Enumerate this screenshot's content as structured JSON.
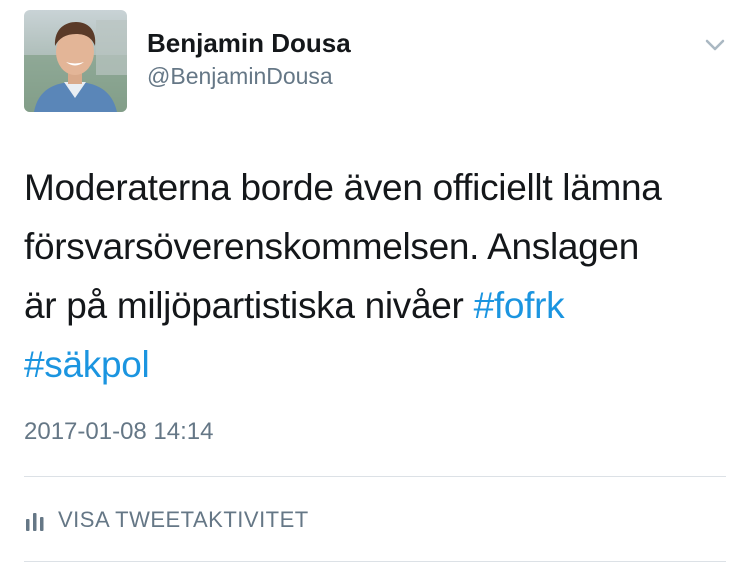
{
  "author": {
    "display_name": "Benjamin Dousa",
    "handle": "@BenjaminDousa",
    "avatar_icon": "profile-photo"
  },
  "menu": {
    "caret_icon": "chevron-down-icon"
  },
  "tweet": {
    "lines": [
      {
        "text": "Moderaterna borde även officiellt lämna"
      },
      {
        "text": "försvarsöverenskommelsen. Anslagen"
      },
      {
        "text": "är på miljöpartistiska nivåer ",
        "hashtag": "#fofrk"
      },
      {
        "hashtag": "#säkpol"
      }
    ],
    "timestamp": "2017-01-08 14:14"
  },
  "activity": {
    "label": "VISA TWEETAKTIVITET",
    "icon": "bar-chart-icon"
  },
  "colors": {
    "text": "#14171a",
    "secondary": "#657786",
    "link": "#1b95e0",
    "divider": "#dce1e6"
  }
}
